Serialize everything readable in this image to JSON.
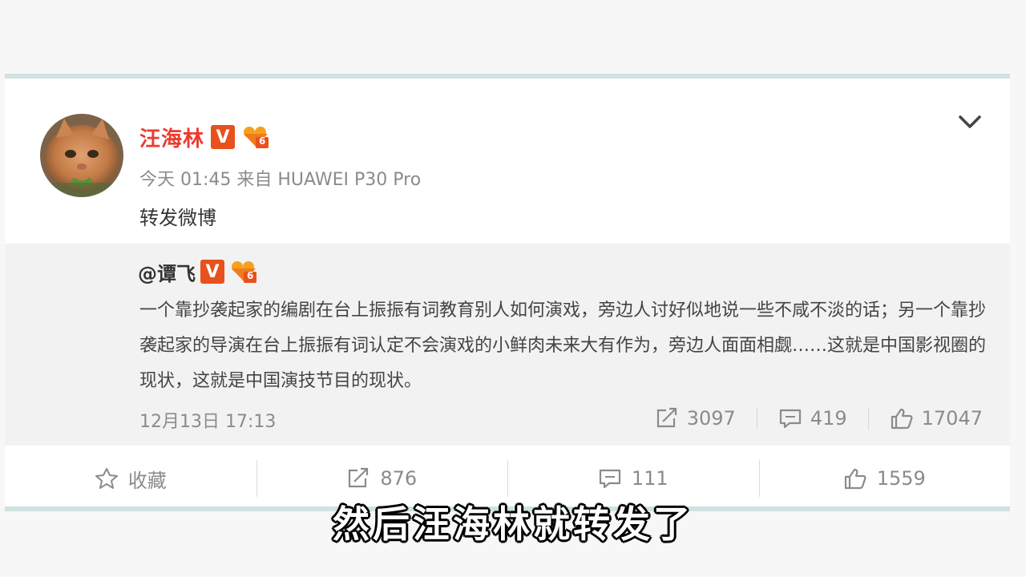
{
  "post": {
    "author": "汪海林",
    "verified_badge": "V",
    "level_badge": "6",
    "meta": "今天 01:45 来自 HUAWEI P30 Pro",
    "text": "转发微博"
  },
  "quoted": {
    "author": "@谭飞",
    "verified_badge": "V",
    "level_badge": "6",
    "text": "一个靠抄袭起家的编剧在台上振振有词教育别人如何演戏，旁边人讨好似地说一些不咸不淡的话；另一个靠抄袭起家的导演在台上振振有词认定不会演戏的小鲜肉未来大有作为，旁边人面面相觑……这就是中国影视圈的现状，这就是中国演技节目的现状。",
    "time": "12月13日 17:13",
    "reposts": "3097",
    "comments": "419",
    "likes": "17047"
  },
  "actions": {
    "favorite": "收藏",
    "reposts": "876",
    "comments": "111",
    "likes": "1559"
  },
  "subtitle": "然后汪海林就转发了",
  "colors": {
    "author_name": "#eb3b2f",
    "verified_badge": "#e8511b",
    "card_border": "#cfe3e1",
    "quoted_background": "#f2f2f2"
  },
  "icons": [
    "cat-avatar",
    "chevron-down-icon",
    "repost-icon",
    "comment-icon",
    "like-icon",
    "star-icon"
  ]
}
